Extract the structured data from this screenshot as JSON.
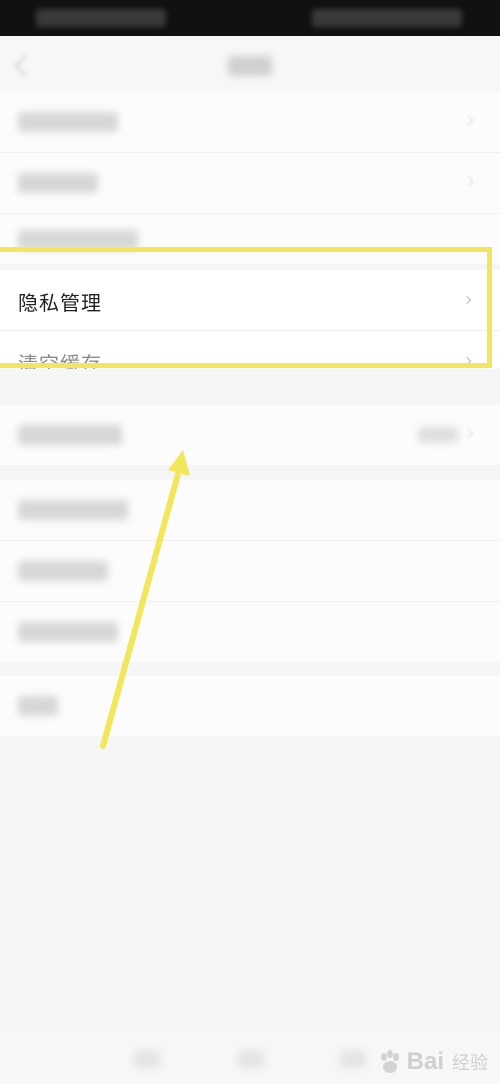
{
  "settings": {
    "privacy_label": "隐私管理",
    "clear_cache_label": "清空缓存"
  },
  "watermark": {
    "brand_prefix": "Bai",
    "brand_suffix": "经验"
  },
  "colors": {
    "highlight": "#f2e65a",
    "arrow": "#f2e65a"
  }
}
